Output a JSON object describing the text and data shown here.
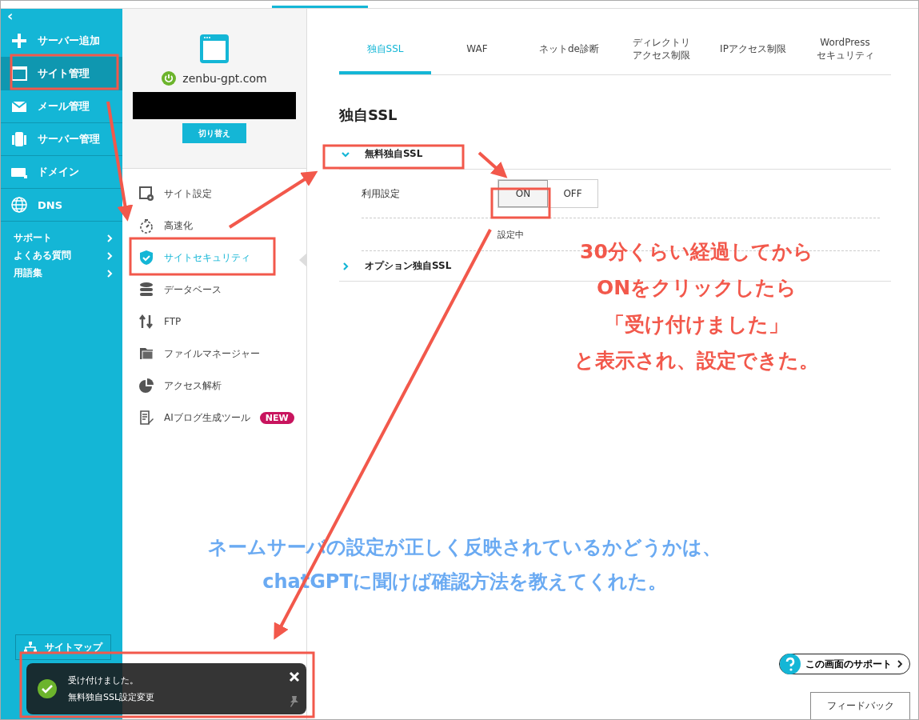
{
  "sidebar": {
    "back": "‹",
    "items": [
      {
        "label": "サーバー追加",
        "selected": false
      },
      {
        "label": "サイト管理",
        "selected": true
      },
      {
        "label": "メール管理",
        "selected": false
      },
      {
        "label": "サーバー管理",
        "selected": false
      },
      {
        "label": "ドメイン",
        "selected": false
      },
      {
        "label": "DNS",
        "selected": false
      }
    ],
    "links": [
      "サポート",
      "よくある質問",
      "用語集"
    ],
    "sitemap_button": "サイトマップ"
  },
  "site_panel": {
    "domain": "zenbu-gpt.com",
    "switch_button": "切り替え",
    "menu": [
      {
        "label": "サイト設定",
        "selected": false
      },
      {
        "label": "高速化",
        "selected": false
      },
      {
        "label": "サイトセキュリティ",
        "selected": true
      },
      {
        "label": "データベース",
        "selected": false
      },
      {
        "label": "FTP",
        "selected": false
      },
      {
        "label": "ファイルマネージャー",
        "selected": false
      },
      {
        "label": "アクセス解析",
        "selected": false
      },
      {
        "label": "AIブログ生成ツール",
        "selected": false,
        "badge": "NEW"
      }
    ]
  },
  "tabs": [
    {
      "lines": [
        "独自SSL"
      ],
      "selected": true
    },
    {
      "lines": [
        "WAF"
      ],
      "selected": false
    },
    {
      "lines": [
        "ネットde診断"
      ],
      "selected": false
    },
    {
      "lines": [
        "ディレクトリ",
        "アクセス制限"
      ],
      "selected": false
    },
    {
      "lines": [
        "IPアクセス制限"
      ],
      "selected": false
    },
    {
      "lines": [
        "WordPress",
        "セキュリティ"
      ],
      "selected": false
    }
  ],
  "heading": "独自SSL",
  "sections": [
    {
      "title": "無料独自SSL",
      "expanded": true,
      "setting_label": "利用設定",
      "options": [
        {
          "label": "ON",
          "selected": true
        },
        {
          "label": "OFF",
          "selected": false
        }
      ],
      "status": "設定中"
    },
    {
      "title": "オプション独自SSL",
      "expanded": false
    }
  ],
  "toast": {
    "title": "受け付けました。",
    "message": "無料独自SSL設定変更"
  },
  "support_button": "この画面のサポート",
  "feedback_button": "フィードバック",
  "annotations": {
    "red_note": [
      "30分くらい経過してから",
      "ONをクリックしたら",
      "「受け付けました」",
      "と表示され、設定できた。"
    ],
    "blue_note": [
      "ネームサーバの設定が正しく反映されているかどうかは、",
      "chatGPTに聞けば確認方法を教えてくれた。"
    ]
  }
}
